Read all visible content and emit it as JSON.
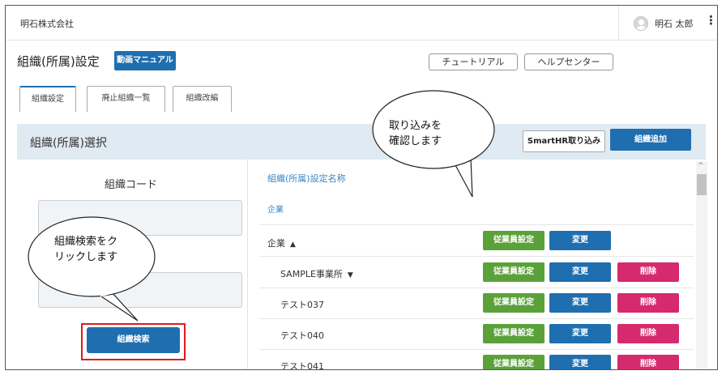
{
  "header": {
    "company": "明石株式会社",
    "user_name": "明石 太郎",
    "menu_glyph": "⋮",
    "user_icon": "user-avatar-icon"
  },
  "page": {
    "title": "組織(所属)設定",
    "manual_button": "動画マニュアル",
    "tutorial_button": "チュートリアル",
    "help_button": "ヘルプセンター"
  },
  "tabs": [
    {
      "label": "組織設定",
      "active": true
    },
    {
      "label": "廃止組織一覧",
      "active": false
    },
    {
      "label": "組織改編",
      "active": false
    }
  ],
  "section": {
    "title": "組織(所属)選択",
    "import_button": "SmartHR取り込み",
    "add_button": "組織追加"
  },
  "search_panel": {
    "code_label": "組織コード",
    "search_button": "組織検索"
  },
  "list": {
    "column_header": "組織(所属)設定名称",
    "root_label": "企業",
    "rows": [
      {
        "name": "企業",
        "caret": "▲",
        "buttons": [
          "従業員設定",
          "変更"
        ]
      },
      {
        "name": "SAMPLE事業所",
        "caret": "▼",
        "buttons": [
          "従業員設定",
          "変更",
          "削除"
        ]
      },
      {
        "name": "テスト037",
        "caret": "",
        "buttons": [
          "従業員設定",
          "変更",
          "削除"
        ]
      },
      {
        "name": "テスト040",
        "caret": "",
        "buttons": [
          "従業員設定",
          "変更",
          "削除"
        ]
      },
      {
        "name": "テスト041",
        "caret": "",
        "buttons": [
          "従業員設定",
          "変更",
          "削除"
        ]
      }
    ]
  },
  "scrollbar": {
    "up_glyph": "^"
  },
  "callouts": {
    "search": {
      "line1": "組織検索をク",
      "line2": "リックします"
    },
    "import": {
      "line1": "取り込みを",
      "line2": "確認します"
    }
  },
  "colors": {
    "primary_blue": "#1f6fb0",
    "green": "#5ba13a",
    "red": "#d52a6d",
    "section_bg": "#dfeaf2",
    "highlight": "#e0191d"
  }
}
